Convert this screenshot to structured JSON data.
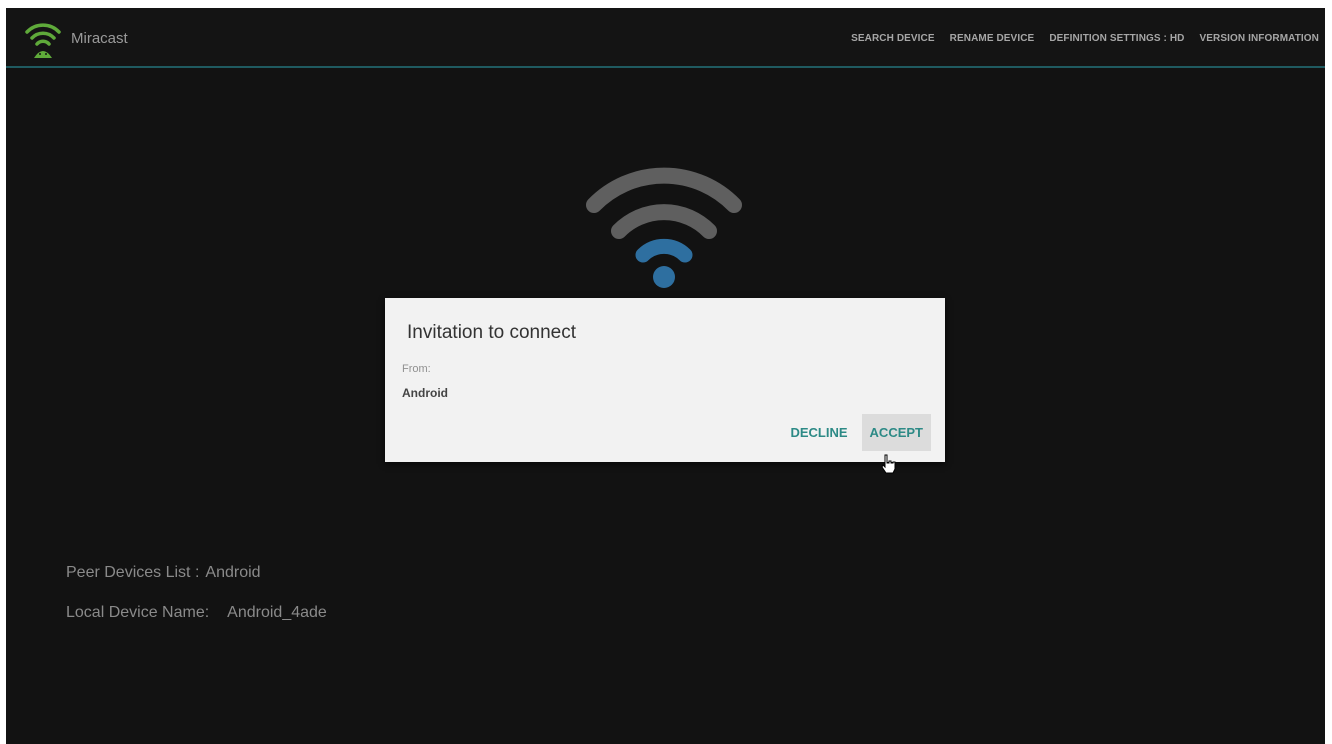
{
  "app": {
    "title": "Miracast",
    "icon": "miracast-wifi-icon"
  },
  "menu": {
    "items": [
      "SEARCH DEVICE",
      "RENAME DEVICE",
      "DEFINITION SETTINGS : HD",
      "VERSION INFORMATION"
    ]
  },
  "center_graphic": {
    "icon": "wifi-signal-icon",
    "colors": {
      "arcs": "#5f5f5f",
      "inner": "#2e6fa0"
    }
  },
  "dialog": {
    "title": "Invitation to connect",
    "from_label": "From:",
    "from_value": "Android",
    "decline_label": "DECLINE",
    "accept_label": "ACCEPT",
    "focused_button": "ACCEPT"
  },
  "info": {
    "peer_label": "Peer Devices List :",
    "peer_value": "Android",
    "local_label": "Local Device Name:",
    "local_value": "Android_4ade"
  },
  "colors": {
    "background": "#121212",
    "accent_line": "#1f5a60",
    "button_text": "#2d8a86",
    "dialog_bg": "#f2f2f2"
  }
}
